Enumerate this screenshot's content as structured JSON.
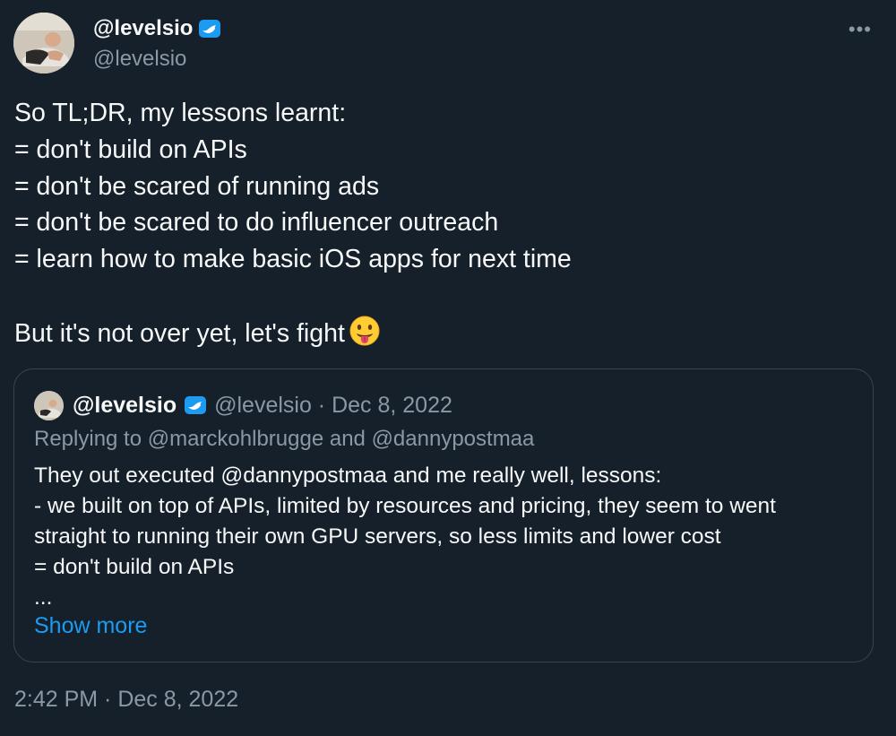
{
  "tweet": {
    "author": {
      "display_name": "@levelsio",
      "handle": "@levelsio",
      "verified_icon": "verified-badge-icon"
    },
    "more_icon": "•••",
    "body_lines": [
      "So TL;DR, my lessons learnt:",
      "= don't build on APIs",
      "= don't be scared of running ads",
      "= don't be scared to do influencer outreach",
      "= learn how to make basic iOS apps for next time",
      "",
      "But it's not over yet, let's fight"
    ],
    "emoji": "tongue-out-emoji-icon",
    "timestamp": "2:42 PM · Dec 8, 2022"
  },
  "quote": {
    "display_name": "@levelsio",
    "meta": "@levelsio · Dec 8, 2022",
    "replying_to": "Replying to @marckohlbrugge and @dannypostmaa",
    "text_lines": [
      "They out executed @dannypostmaa and me really well, lessons:",
      "- we built on top of APIs, limited by resources and pricing, they seem to went",
      "straight to running their own GPU servers, so less limits and lower cost",
      "= don't build on APIs",
      "..."
    ],
    "show_more_label": "Show more"
  },
  "colors": {
    "background": "#15202b",
    "text": "#f7f9f9",
    "secondary_text": "#8b98a5",
    "link": "#1d9bf0",
    "border": "#38444d",
    "verified": "#1d9bf0"
  }
}
